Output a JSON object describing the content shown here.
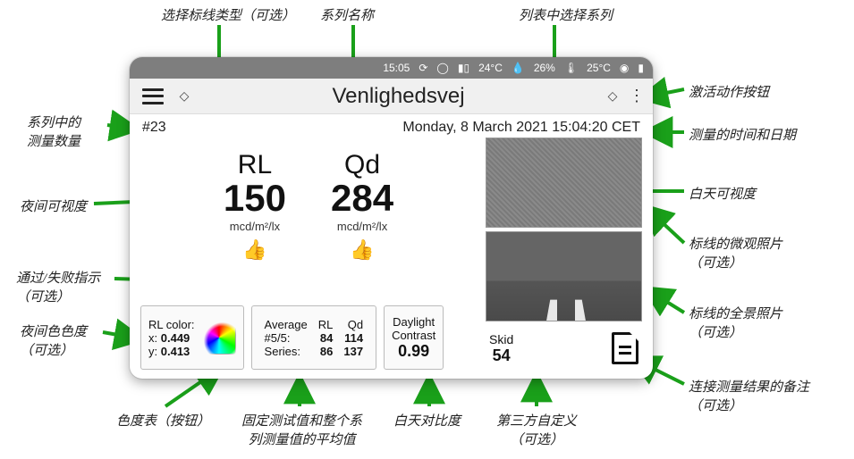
{
  "annotations": {
    "select_marking_type": "选择标线类型（可选）",
    "series_name": "系列名称",
    "select_series_from_list": "列表中选择系列",
    "activate_action_button": "激活动作按钮",
    "measurement_count": "系列中的\n测量数量",
    "night_visibility": "夜间可视度",
    "pass_fail_indicator": "通过/失败指示\n（可选）",
    "night_chromaticity": "夜间色色度\n（可选）",
    "chromaticity_button": "色度表（按钮）",
    "averages": "固定测试值和整个系\n列测量值的平均值",
    "daylight_contrast": "白天对比度",
    "third_party": "第三方自定义\n（可选）",
    "notes": "连接测量结果的备注\n（可选）",
    "pano_photo": "标线的全景照片\n（可选）",
    "micro_photo": "标线的微观照片\n（可选）",
    "day_visibility": "白天可视度",
    "measure_datetime": "测量的时间和日期"
  },
  "statusbar": {
    "time": "15:05",
    "temp_ext": "24°C",
    "humidity": "26%",
    "temp_int": "25°C"
  },
  "header": {
    "title": "Venlighedsvej"
  },
  "sub": {
    "index": "#23",
    "datetime": "Monday, 8 March 2021 15:04:20 CET"
  },
  "readings": {
    "rl": {
      "label": "RL",
      "value": "150",
      "unit": "mcd/m²/lx"
    },
    "qd": {
      "label": "Qd",
      "value": "284",
      "unit": "mcd/m²/lx"
    }
  },
  "rlcolor": {
    "title": "RL color:",
    "x_label": "x:",
    "x_value": "0.449",
    "y_label": "y:",
    "y_value": "0.413"
  },
  "averages": {
    "hdr_col1": "Average",
    "hdr_col2": "RL",
    "hdr_col3": "Qd",
    "row1_label": "#5/5:",
    "row1_rl": "84",
    "row1_qd": "114",
    "row2_label": "Series:",
    "row2_rl": "86",
    "row2_qd": "137"
  },
  "daylight": {
    "line1": "Daylight",
    "line2": "Contrast",
    "value": "0.99"
  },
  "skid": {
    "label": "Skid",
    "value": "54"
  }
}
